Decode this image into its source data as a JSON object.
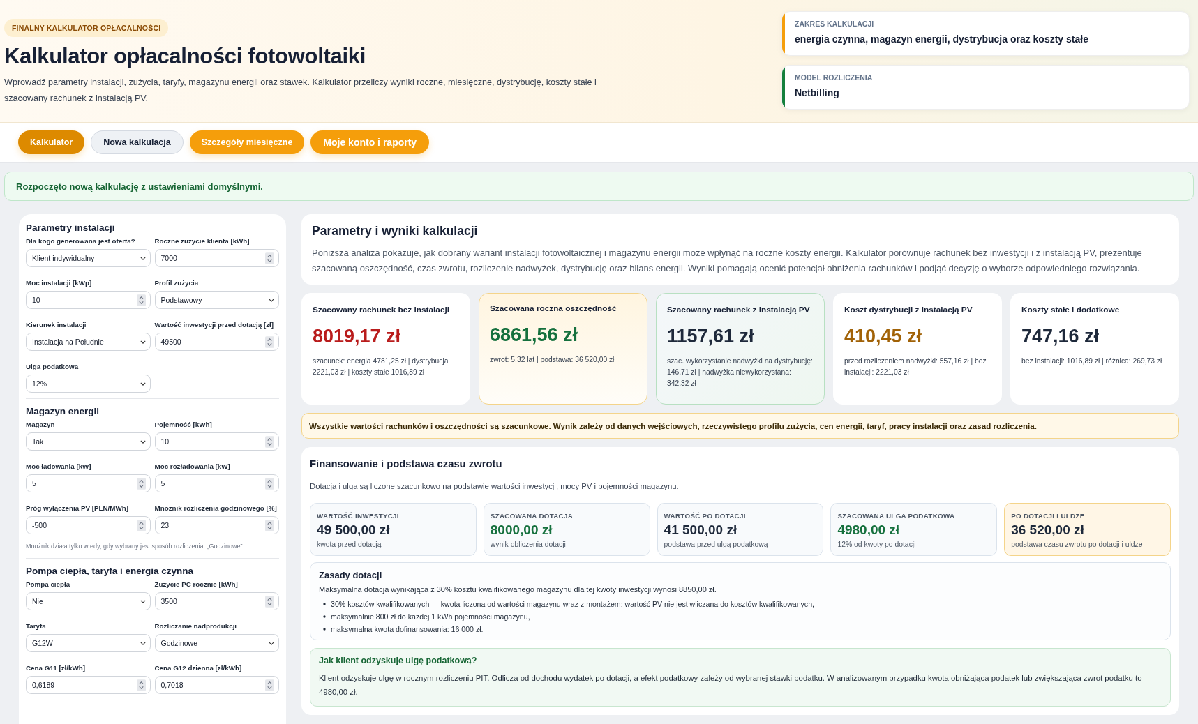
{
  "header": {
    "badge": "FINALNY KALKULATOR OPŁACALNOŚCI",
    "title": "Kalkulator opłacalności fotowoltaiki",
    "description": "Wprowadź parametry instalacji, zużycia, taryfy, magazynu energii oraz stawek. Kalkulator przeliczy wyniki roczne, miesięczne, dystrybucję, koszty stałe i szacowany rachunek z instalacją PV."
  },
  "info_cards": [
    {
      "label": "ZAKRES KALKULACJI",
      "value": "energia czynna, magazyn energii, dystrybucja oraz koszty stałe",
      "color": "#f59e0b"
    },
    {
      "label": "MODEL ROZLICZENIA",
      "value": "Netbilling",
      "color": "#15803d"
    }
  ],
  "tabs": [
    {
      "label": "Kalkulator",
      "kind": "nav",
      "selected": true
    },
    {
      "label": "Nowa kalkulacja",
      "kind": "outline",
      "selected": false
    },
    {
      "label": "Szczegóły miesięczne",
      "kind": "nav",
      "selected": false
    },
    {
      "label": "Moje konto i raporty",
      "kind": "account",
      "selected": false
    }
  ],
  "alert": "Rozpoczęto nową kalkulację z ustawieniami domyślnymi.",
  "form": {
    "sections": [
      {
        "title": "Parametry instalacji",
        "fields": [
          {
            "label": "Dla kogo generowana jest oferta?",
            "value": "Klient indywidualny",
            "kind": "select"
          },
          {
            "label": "Roczne zużycie klienta [kWh]",
            "value": "7000",
            "kind": "number"
          },
          {
            "label": "Moc instalacji [kWp]",
            "value": "10",
            "kind": "number"
          },
          {
            "label": "Profil zużycia",
            "value": "Podstawowy",
            "kind": "select"
          },
          {
            "label": "Kierunek instalacji",
            "value": "Instalacja na Południe",
            "kind": "select"
          },
          {
            "label": "Wartość inwestycji przed dotacją [zł]",
            "value": "49500",
            "kind": "number"
          },
          {
            "label": "Ulga podatkowa",
            "value": "12%",
            "kind": "select"
          }
        ]
      },
      {
        "title": "Magazyn energii",
        "fields": [
          {
            "label": "Magazyn",
            "value": "Tak",
            "kind": "select"
          },
          {
            "label": "Pojemność [kWh]",
            "value": "10",
            "kind": "number"
          },
          {
            "label": "Moc ładowania [kW]",
            "value": "5",
            "kind": "number"
          },
          {
            "label": "Moc rozładowania [kW]",
            "value": "5",
            "kind": "number"
          },
          {
            "label": "Próg wyłączenia PV [PLN/MWh]",
            "value": "-500",
            "kind": "number"
          },
          {
            "label": "Mnożnik rozliczenia godzinowego [%]",
            "value": "23",
            "kind": "number"
          }
        ],
        "note": "Mnożnik działa tylko wtedy, gdy wybrany jest sposób rozliczenia: „Godzinowe”."
      },
      {
        "title": "Pompa ciepła, taryfa i energia czynna",
        "fields": [
          {
            "label": "Pompa ciepła",
            "value": "Nie",
            "kind": "select"
          },
          {
            "label": "Zużycie PC rocznie [kWh]",
            "value": "3500",
            "kind": "number"
          },
          {
            "label": "Taryfa",
            "value": "G12W",
            "kind": "select"
          },
          {
            "label": "Rozliczanie nadprodukcji",
            "value": "Godzinowe",
            "kind": "select"
          },
          {
            "label": "Cena G11 [zł/kWh]",
            "value": "0,6189",
            "kind": "number"
          },
          {
            "label": "Cena G12 dzienna [zł/kWh]",
            "value": "0,7018",
            "kind": "number"
          }
        ]
      }
    ]
  },
  "results": {
    "title": "Parametry i wyniki kalkulacji",
    "description": "Poniższa analiza pokazuje, jak dobrany wariant instalacji fotowoltaicznej i magazynu energii może wpłynąć na roczne koszty energii. Kalkulator porównuje rachunek bez inwestycji i z instalacją PV, prezentuje szacowaną oszczędność, czas zwrotu, rozliczenie nadwyżek, dystrybucję oraz bilans energii. Wyniki pomagają ocenić potencjał obniżenia rachunków i podjąć decyzję o wyborze odpowiedniego rozwiązania.",
    "stats": [
      {
        "title": "Szacowany rachunek bez instalacji",
        "value": "8019,17 zł",
        "detail": "szacunek: energia 4781,25 zł | dystrybucja 2221,03 zł | koszty stałe 1016,89 zł",
        "color": "#b91c1c",
        "kind": "plain"
      },
      {
        "title": "Szacowana roczna oszczędność",
        "value": "6861,56 zł",
        "detail": "zwrot: 5,32 lat | podstawa: 36 520,00 zł",
        "color": "#15703d",
        "kind": "warm"
      },
      {
        "title": "Szacowany rachunek z instalacją PV",
        "value": "1157,61 zł",
        "detail": "szac. wykorzystanie nadwyżki na dystrybucję: 146,71 zł | nadwyżka niewykorzystana: 342,32 zł",
        "color": "#1e293b",
        "kind": "cool"
      },
      {
        "title": "Koszt dystrybucji z instalacją PV",
        "value": "410,45 zł",
        "detail": "przed rozliczeniem nadwyżki: 557,16 zł | bez instalacji: 2221,03 zł",
        "color": "#a16207",
        "kind": "plain"
      },
      {
        "title": "Koszty stałe i dodatkowe",
        "value": "747,16 zł",
        "detail": "bez instalacji: 1016,89 zł | różnica: 269,73 zł",
        "color": "#1e293b",
        "kind": "plain"
      }
    ],
    "warning": "Wszystkie wartości rachunków i oszczędności są szacunkowe. Wynik zależy od danych wejściowych, rzeczywistego profilu zużycia, cen energii, taryf, pracy instalacji oraz zasad rozliczenia."
  },
  "financing": {
    "title": "Finansowanie i podstawa czasu zwrotu",
    "description": "Dotacja i ulga są liczone szacunkowo na podstawie wartości inwestycji, mocy PV i pojemności magazynu.",
    "tiles": [
      {
        "label": "WARTOŚĆ INWESTYCJI",
        "value": "49 500,00 zł",
        "sub": "kwota przed dotacją",
        "color": "#1e293b",
        "kind": "plain"
      },
      {
        "label": "SZACOWANA DOTACJA",
        "value": "8000,00 zł",
        "sub": "wynik obliczenia dotacji",
        "color": "#15703d",
        "kind": "plain"
      },
      {
        "label": "WARTOŚĆ PO DOTACJI",
        "value": "41 500,00 zł",
        "sub": "podstawa przed ulgą podatkową",
        "color": "#1e293b",
        "kind": "plain"
      },
      {
        "label": "SZACOWANA ULGA PODATKOWA",
        "value": "4980,00 zł",
        "sub": "12% od kwoty po dotacji",
        "color": "#15703d",
        "kind": "plain"
      },
      {
        "label": "PO DOTACJI I ULDZE",
        "value": "36 520,00 zł",
        "sub": "podstawa czasu zwrotu po dotacji i uldze",
        "color": "#1e293b",
        "kind": "highlight"
      }
    ],
    "rules": {
      "title": "Zasady dotacji",
      "intro": "Maksymalna dotacja wynikająca z 30% kosztu kwalifikowanego magazynu dla tej kwoty inwestycji wynosi 8850,00 zł.",
      "items": [
        "30% kosztów kwalifikowanych — kwota liczona od wartości magazynu wraz z montażem; wartość PV nie jest wliczana do kosztów kwalifikowanych,",
        "maksymalnie 800 zł do każdej 1 kWh pojemności magazynu,",
        "maksymalna kwota dofinansowania: 16 000 zł."
      ]
    },
    "tax": {
      "title": "Jak klient odzyskuje ulgę podatkową?",
      "text": "Klient odzyskuje ulgę w rocznym rozliczeniu PIT. Odlicza od dochodu wydatek po dotacji, a efekt podatkowy zależy od wybranej stawki podatku. W analizowanym przypadku kwota obniżająca podatek lub zwiększająca zwrot podatku to 4980,00 zł."
    }
  }
}
